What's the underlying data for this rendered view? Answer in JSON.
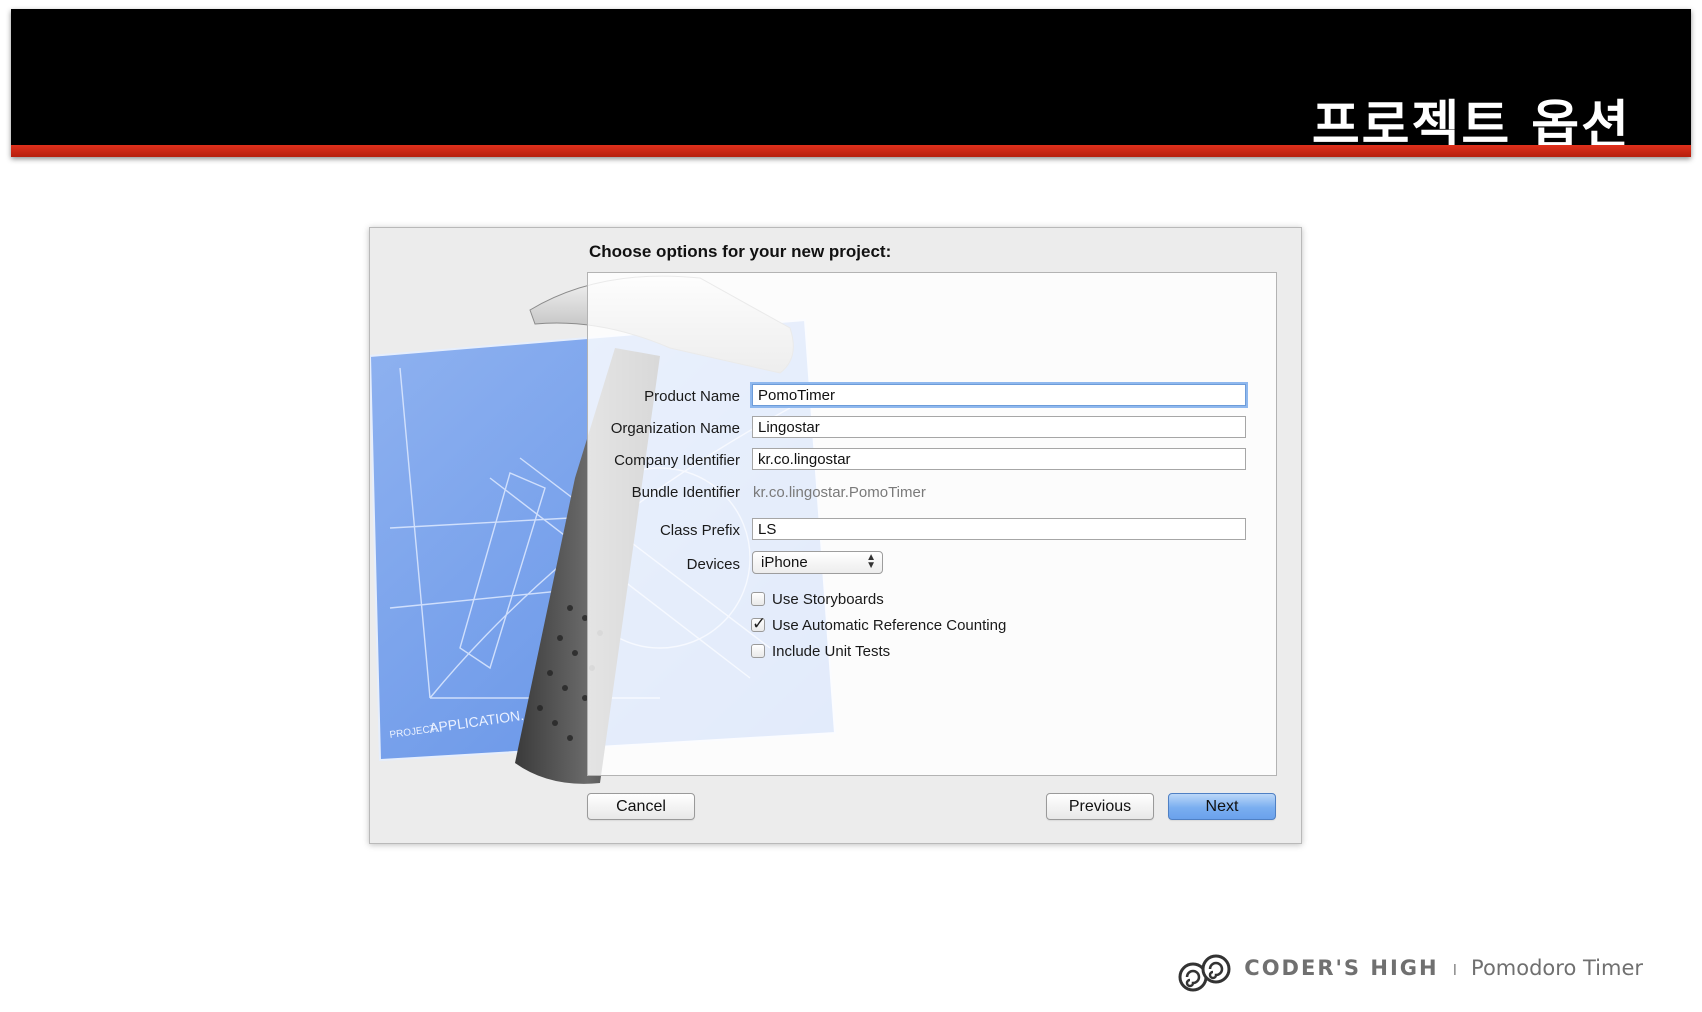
{
  "slide": {
    "title": "프로젝트 옵션",
    "accent_color": "#d42a16"
  },
  "dialog": {
    "heading": "Choose options for your new project:",
    "fields": {
      "product_name": {
        "label": "Product Name",
        "value": "PomoTimer"
      },
      "organization_name": {
        "label": "Organization Name",
        "value": "Lingostar"
      },
      "company_identifier": {
        "label": "Company Identifier",
        "value": "kr.co.lingostar"
      },
      "bundle_identifier": {
        "label": "Bundle Identifier",
        "value": "kr.co.lingostar.PomoTimer"
      },
      "class_prefix": {
        "label": "Class Prefix",
        "value": "LS"
      },
      "devices": {
        "label": "Devices",
        "value": "iPhone"
      }
    },
    "checkboxes": {
      "use_storyboards": {
        "label": "Use Storyboards",
        "checked": false
      },
      "use_arc": {
        "label": "Use Automatic Reference Counting",
        "checked": true
      },
      "include_unit_tests": {
        "label": "Include Unit Tests",
        "checked": false
      }
    },
    "buttons": {
      "cancel": "Cancel",
      "previous": "Previous",
      "next": "Next"
    },
    "blueprint_text": {
      "project_label": "PROJECT:",
      "app_label": "APPLICATION.APP"
    }
  },
  "footer": {
    "brand": "CODER'S HIGH",
    "separator": "I",
    "product": "Pomodoro Timer"
  }
}
